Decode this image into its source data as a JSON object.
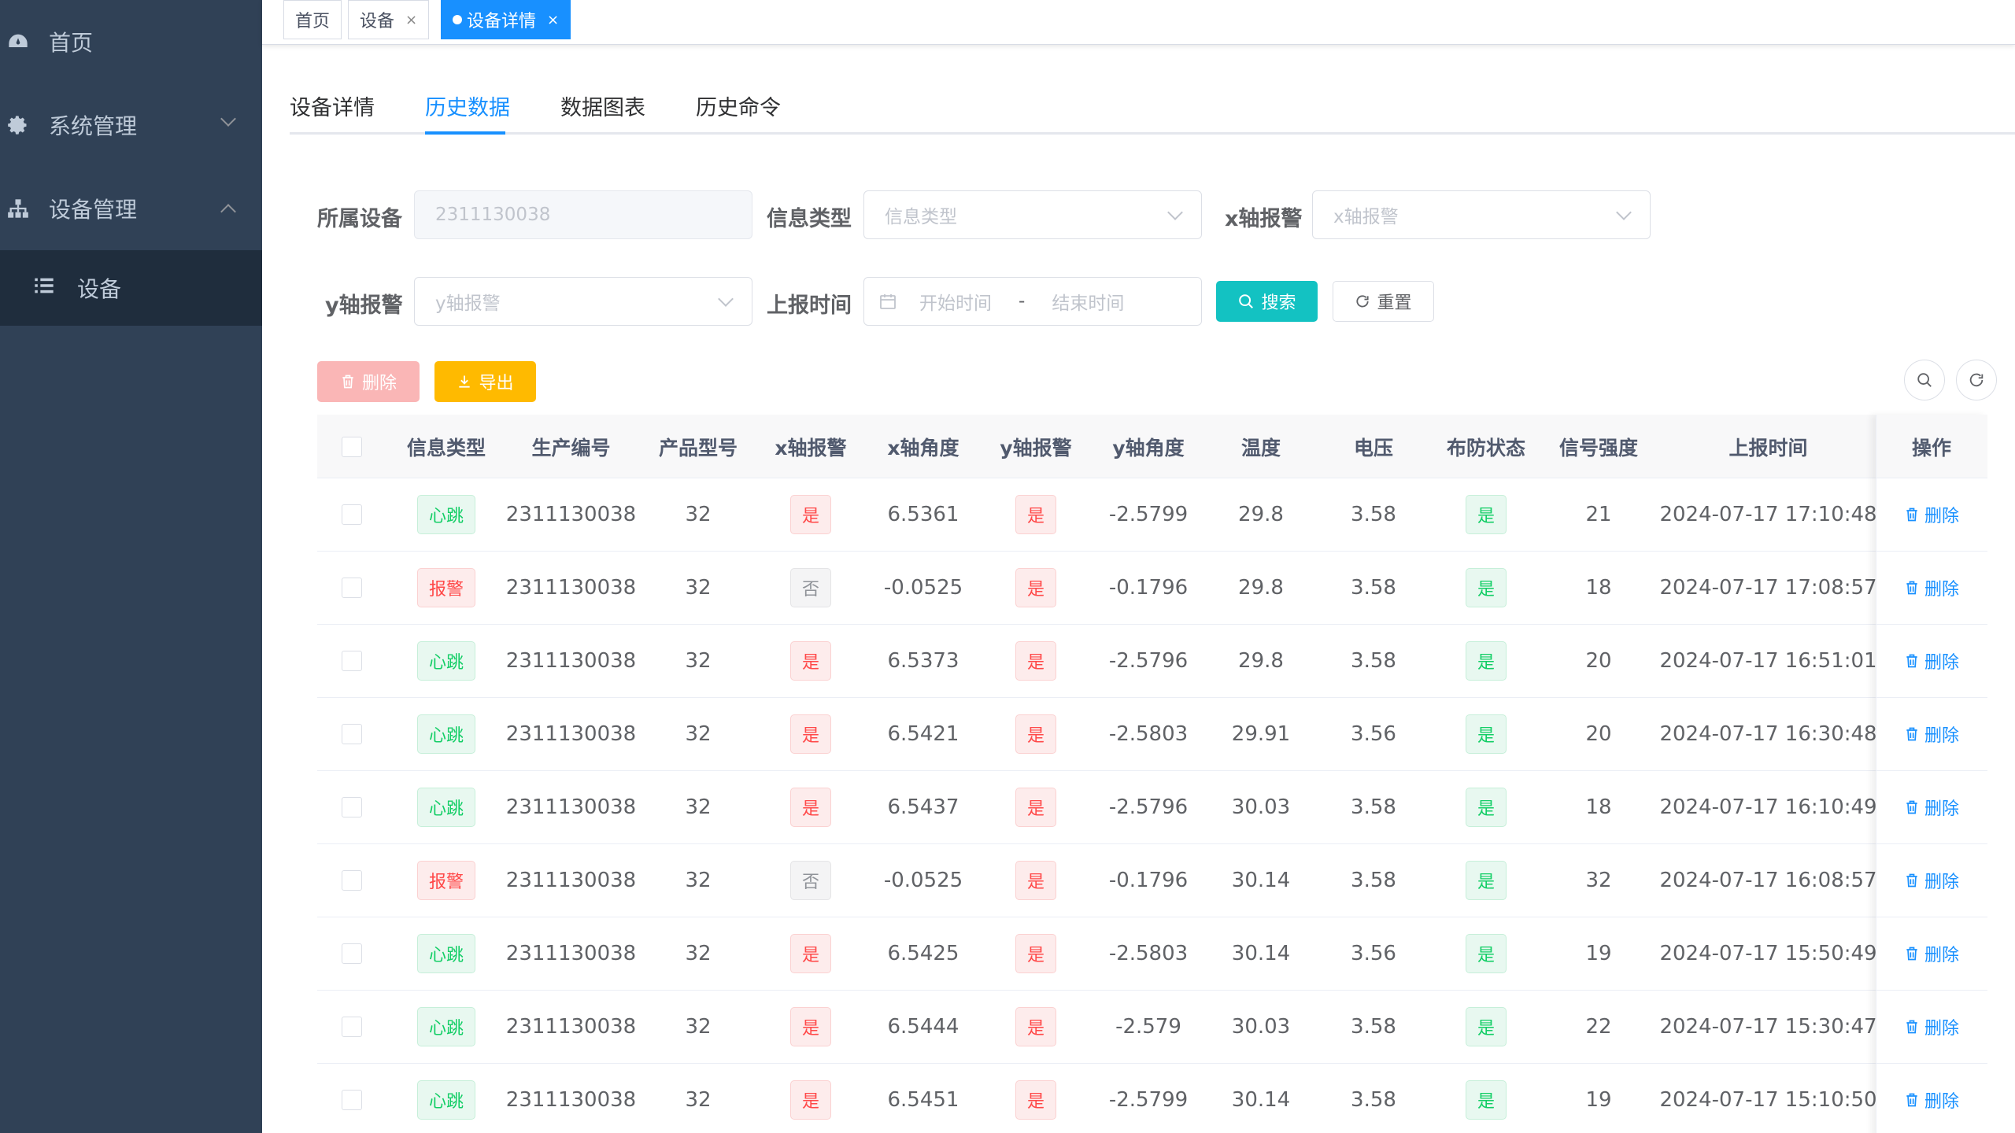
{
  "sidebar": {
    "items": [
      {
        "label": "首页"
      },
      {
        "label": "系统管理"
      },
      {
        "label": "设备管理"
      }
    ],
    "sub_items": [
      {
        "label": "设备"
      }
    ]
  },
  "tags": [
    {
      "label": "首页"
    },
    {
      "label": "设备",
      "close": "×"
    },
    {
      "label": "设备详情",
      "close": "×"
    }
  ],
  "tabs": [
    {
      "label": "设备详情"
    },
    {
      "label": "历史数据"
    },
    {
      "label": "数据图表"
    },
    {
      "label": "历史命令"
    }
  ],
  "form": {
    "device_label": "所属设备",
    "device_value": "2311130038",
    "info_type_label": "信息类型",
    "info_type_placeholder": "信息类型",
    "x_alarm_label": "x轴报警",
    "x_alarm_placeholder": "x轴报警",
    "y_alarm_label": "y轴报警",
    "y_alarm_placeholder": "y轴报警",
    "report_time_label": "上报时间",
    "start_placeholder": "开始时间",
    "range_sep": "-",
    "end_placeholder": "结束时间",
    "search_btn": "搜索",
    "reset_btn": "重置"
  },
  "toolbar": {
    "delete_btn": "删除",
    "export_btn": "导出"
  },
  "table": {
    "headers": [
      "信息类型",
      "生产编号",
      "产品型号",
      "x轴报警",
      "x轴角度",
      "y轴报警",
      "y轴角度",
      "温度",
      "电压",
      "布防状态",
      "信号强度",
      "上报时间",
      "操作"
    ],
    "op_label": "删除",
    "rows": [
      {
        "type": "心跳",
        "serial": "2311130038",
        "model": "32",
        "x_alarm": "是",
        "x_angle": "6.5361",
        "y_alarm": "是",
        "y_angle": "-2.5799",
        "temp": "29.8",
        "voltage": "3.58",
        "armed": "是",
        "signal": "21",
        "time": "2024-07-17 17:10:48"
      },
      {
        "type": "报警",
        "serial": "2311130038",
        "model": "32",
        "x_alarm": "否",
        "x_angle": "-0.0525",
        "y_alarm": "是",
        "y_angle": "-0.1796",
        "temp": "29.8",
        "voltage": "3.58",
        "armed": "是",
        "signal": "18",
        "time": "2024-07-17 17:08:57"
      },
      {
        "type": "心跳",
        "serial": "2311130038",
        "model": "32",
        "x_alarm": "是",
        "x_angle": "6.5373",
        "y_alarm": "是",
        "y_angle": "-2.5796",
        "temp": "29.8",
        "voltage": "3.58",
        "armed": "是",
        "signal": "20",
        "time": "2024-07-17 16:51:01"
      },
      {
        "type": "心跳",
        "serial": "2311130038",
        "model": "32",
        "x_alarm": "是",
        "x_angle": "6.5421",
        "y_alarm": "是",
        "y_angle": "-2.5803",
        "temp": "29.91",
        "voltage": "3.56",
        "armed": "是",
        "signal": "20",
        "time": "2024-07-17 16:30:48"
      },
      {
        "type": "心跳",
        "serial": "2311130038",
        "model": "32",
        "x_alarm": "是",
        "x_angle": "6.5437",
        "y_alarm": "是",
        "y_angle": "-2.5796",
        "temp": "30.03",
        "voltage": "3.58",
        "armed": "是",
        "signal": "18",
        "time": "2024-07-17 16:10:49"
      },
      {
        "type": "报警",
        "serial": "2311130038",
        "model": "32",
        "x_alarm": "否",
        "x_angle": "-0.0525",
        "y_alarm": "是",
        "y_angle": "-0.1796",
        "temp": "30.14",
        "voltage": "3.58",
        "armed": "是",
        "signal": "32",
        "time": "2024-07-17 16:08:57"
      },
      {
        "type": "心跳",
        "serial": "2311130038",
        "model": "32",
        "x_alarm": "是",
        "x_angle": "6.5425",
        "y_alarm": "是",
        "y_angle": "-2.5803",
        "temp": "30.14",
        "voltage": "3.56",
        "armed": "是",
        "signal": "19",
        "time": "2024-07-17 15:50:49"
      },
      {
        "type": "心跳",
        "serial": "2311130038",
        "model": "32",
        "x_alarm": "是",
        "x_angle": "6.5444",
        "y_alarm": "是",
        "y_angle": "-2.579",
        "temp": "30.03",
        "voltage": "3.58",
        "armed": "是",
        "signal": "22",
        "time": "2024-07-17 15:30:47"
      },
      {
        "type": "心跳",
        "serial": "2311130038",
        "model": "32",
        "x_alarm": "是",
        "x_angle": "6.5451",
        "y_alarm": "是",
        "y_angle": "-2.5799",
        "temp": "30.14",
        "voltage": "3.58",
        "armed": "是",
        "signal": "19",
        "time": "2024-07-17 15:10:50"
      }
    ]
  }
}
